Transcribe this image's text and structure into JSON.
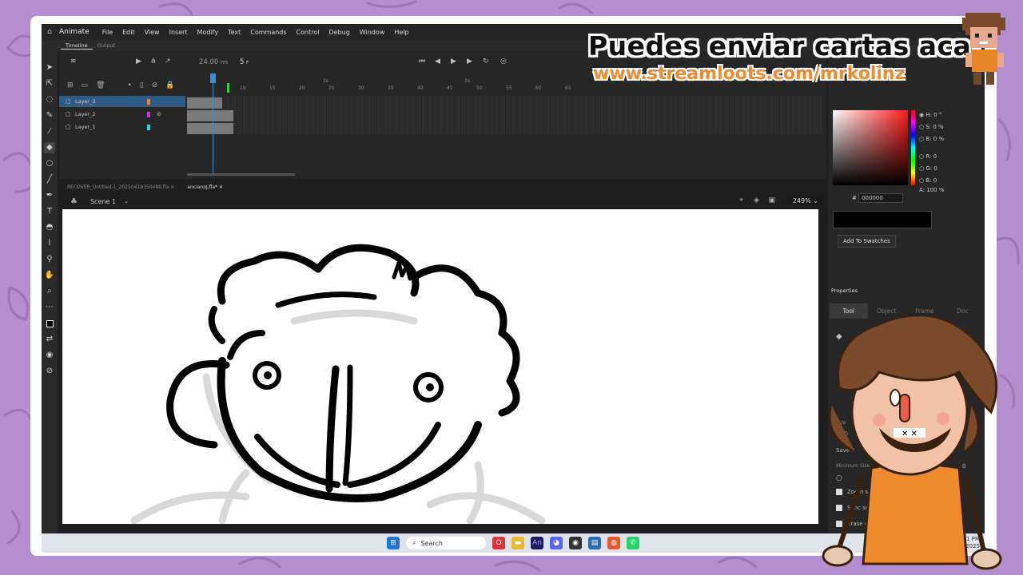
{
  "menubar": {
    "app_name": "Animate",
    "items": [
      "File",
      "Edit",
      "View",
      "Insert",
      "Modify",
      "Text",
      "Commands",
      "Control",
      "Debug",
      "Window",
      "Help"
    ]
  },
  "timeline_tabs": [
    "Timeline",
    "Output"
  ],
  "timeline": {
    "fps": "24.00",
    "fps_unit": "FPS",
    "current_frame": "5",
    "frame_suffix": "F",
    "ruler_seconds": [
      "1s",
      "2s"
    ],
    "ruler_ticks": [
      "10",
      "15",
      "20",
      "25",
      "30",
      "35",
      "40",
      "45",
      "50",
      "55",
      "60",
      "65"
    ],
    "layers": [
      {
        "name": "Layer_3",
        "color": "#e8862a",
        "selected": true
      },
      {
        "name": "Layer_2",
        "color": "#c33ad6",
        "hidden": true
      },
      {
        "name": "Layer_1",
        "color": "#36d6e0"
      }
    ]
  },
  "documents": [
    {
      "name": "RECOVER_Untitled-1_20250418350488.fla",
      "active": false
    },
    {
      "name": "ancianoJ.fla*",
      "active": true
    }
  ],
  "scene": {
    "label": "Scene 1",
    "zoom": "249%"
  },
  "color_panel": {
    "H": "0 °",
    "S": "0 %",
    "B": "0 %",
    "R": "0",
    "G": "0",
    "Bv": "0",
    "hex": "000000",
    "alpha": "100 %",
    "add_label": "Add To Swatches"
  },
  "properties": {
    "title": "Properties",
    "tabs": [
      "Tool",
      "Object",
      "Frame",
      "Doc"
    ],
    "size_label": "Size",
    "save_label": "Save a",
    "min_size_label": "Minimum Size",
    "min_size_value": "0",
    "options": [
      "Zoom size",
      "Sync setti",
      "Erase on"
    ]
  },
  "taskbar": {
    "search": "Search",
    "time": "1 PM",
    "date": "2025"
  },
  "banner": {
    "line1": "Puedes enviar cartas aca:",
    "line2": "www.streamloots.com/mrkolinz"
  },
  "colors": {
    "accent": "#2f5b87",
    "playhead": "#3b8ed6",
    "background": "#b48fcf",
    "banner_orange": "#ef8a2d"
  }
}
